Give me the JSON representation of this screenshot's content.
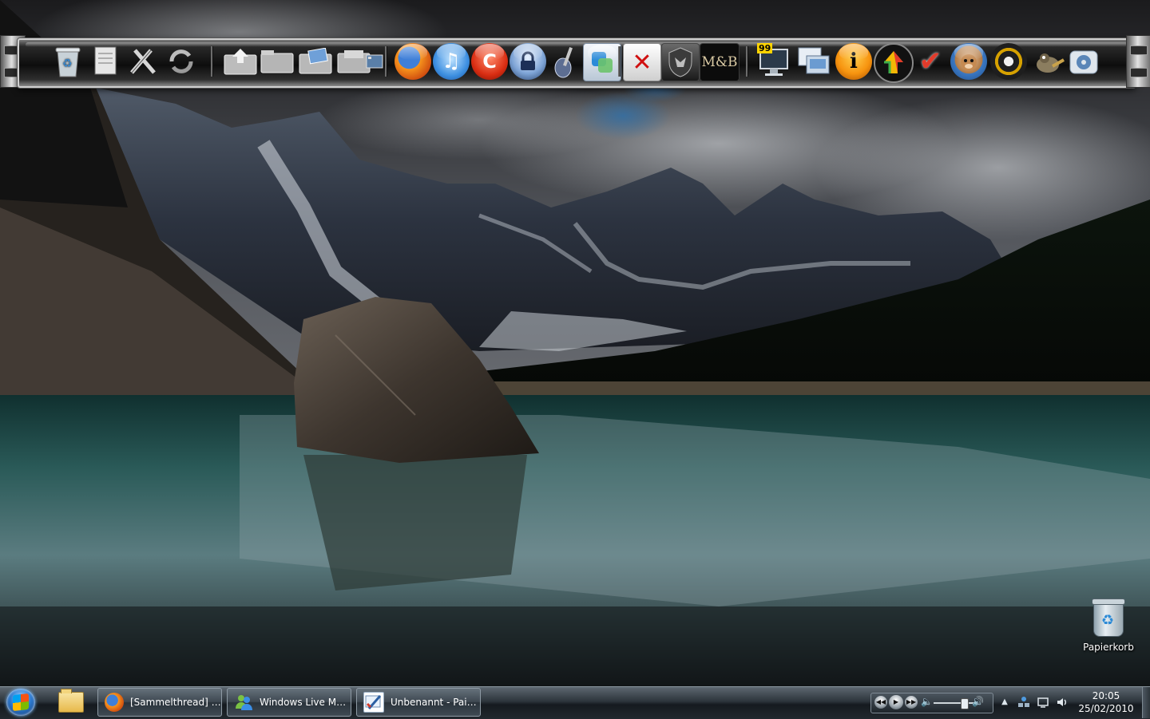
{
  "desktop": {
    "wallpaper": "Moraine Lake mountain reflection (HDR)",
    "icons": [
      {
        "label": "Papierkorb",
        "icon": "recycle-bin-icon"
      }
    ]
  },
  "dock": {
    "icons": [
      {
        "icon": "recycle-bin-icon"
      },
      {
        "icon": "document-icon"
      },
      {
        "icon": "tools-icon"
      },
      {
        "icon": "refresh-icon"
      },
      {
        "icon": "folder-up-icon"
      },
      {
        "icon": "folder-icon"
      },
      {
        "icon": "picture-folder-icon"
      },
      {
        "icon": "folder-icon"
      },
      {
        "icon": "film-folder-icon"
      },
      {
        "icon": "firefox-icon"
      },
      {
        "icon": "itunes-icon"
      },
      {
        "icon": "ccleaner-icon"
      },
      {
        "icon": "keepass-lock-icon"
      },
      {
        "icon": "guitar-icon"
      },
      {
        "icon": "sync-icon"
      },
      {
        "icon": "close-x-icon",
        "text": "✕",
        "color": "#d01010"
      },
      {
        "icon": "dragon-shield-icon"
      },
      {
        "icon": "mount-and-blade-icon",
        "text": "M&B"
      },
      {
        "icon": "computer-icon",
        "text": "99"
      },
      {
        "icon": "windows-explorer-icon"
      },
      {
        "icon": "info-icon",
        "text": "i"
      },
      {
        "icon": "upload-arrow-icon"
      },
      {
        "icon": "checkmark-icon",
        "text": "✔"
      },
      {
        "icon": "monkey-icon"
      },
      {
        "icon": "media-player-icon"
      },
      {
        "icon": "gimp-icon"
      },
      {
        "icon": "media-player-app-icon"
      }
    ]
  },
  "taskbar": {
    "start_icon": "windows-orb-icon",
    "pinned": [
      {
        "icon": "windows-explorer-folder-icon"
      }
    ],
    "tasks": [
      {
        "label": "[Sammelthread] Z...",
        "icon": "firefox-icon"
      },
      {
        "label": "Windows Live Me...",
        "icon": "windows-live-messenger-icon"
      },
      {
        "label": "Unbenannt - Pain...",
        "icon": "paint-icon"
      }
    ],
    "player_controls": [
      "previous-icon",
      "play-icon",
      "next-icon",
      "volume-icon"
    ],
    "tray_icons": [
      "show-hidden-icons-arrow",
      "network-icon",
      "action-center-icon",
      "speaker-icon"
    ],
    "clock": {
      "time": "20:05",
      "date": "25/02/2010"
    }
  }
}
